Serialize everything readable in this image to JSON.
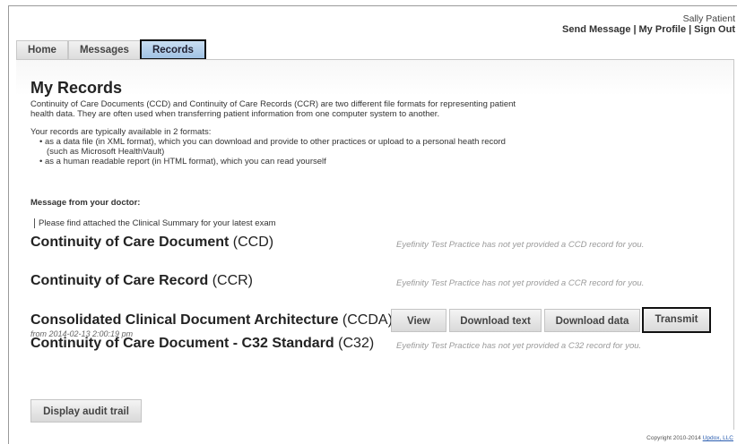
{
  "header": {
    "user_name": "Sally Patient",
    "links": [
      "Send Message",
      "My Profile",
      "Sign Out"
    ],
    "separator": "|"
  },
  "tabs": [
    {
      "label": "Home",
      "active": false
    },
    {
      "label": "Messages",
      "active": false
    },
    {
      "label": "Records",
      "active": true
    }
  ],
  "page": {
    "title": "My Records",
    "intro_line1": "Continuity of Care Documents (CCD) and Continuity of Care Records (CCR) are two different file formats for representing patient",
    "intro_line2": "health data. They are often used when transferring patient information from one computer system to another.",
    "formats_intro": "Your records are typically available in 2 formats:",
    "format1_line1": "as a data file (in XML format), which you can download and provide to other practices or upload to a personal heath record",
    "format1_line2": "(such as Microsoft HealthVault)",
    "format2": "as a human readable report (in HTML format), which you can read yourself",
    "message_heading": "Message from your doctor:",
    "message_text": "Please find attached the Clinical Summary for your latest exam"
  },
  "records": {
    "ccd": {
      "name": "Continuity of Care Document",
      "abbr": "(CCD)",
      "note": "Eyefinity Test Practice has not yet provided a CCD record for you."
    },
    "ccr": {
      "name": "Continuity of Care Record",
      "abbr": "(CCR)",
      "note": "Eyefinity Test Practice has not yet provided a CCR record for you."
    },
    "ccda": {
      "name": "Consolidated Clinical Document Architecture",
      "abbr": "(CCDA)",
      "date": "from 2014-02-13 2:00:19 pm",
      "buttons": {
        "view": "View",
        "download_text": "Download text",
        "download_data": "Download data",
        "transmit": "Transmit"
      }
    },
    "c32": {
      "name": "Continuity of Care Document - C32 Standard",
      "abbr": "(C32)",
      "note": "Eyefinity Test Practice has not yet provided a C32 record for you."
    }
  },
  "audit_button": "Display audit trail",
  "footer": {
    "copyright": "Copyright 2010-2014",
    "company": "Updox, LLC"
  }
}
